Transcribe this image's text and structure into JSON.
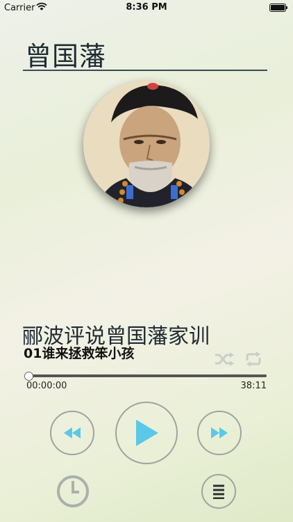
{
  "status_bar": {
    "carrier": "Carrier",
    "time": "8:36 PM",
    "wifi_icon": "wifi-icon",
    "battery_icon": "battery-icon"
  },
  "header": {
    "title": "曾国藩"
  },
  "artwork": {
    "icon": "portrait-image"
  },
  "track": {
    "title": "郦波评说曾国藩家训",
    "subtitle": "01谁来拯救笨小孩"
  },
  "modes": {
    "shuffle_icon": "shuffle-icon",
    "repeat_icon": "repeat-icon"
  },
  "progress": {
    "elapsed": "00:00:00",
    "total": "38:11",
    "fraction": 0.0
  },
  "controls": {
    "rewind_icon": "rewind-icon",
    "play_icon": "play-icon",
    "forward_icon": "fast-forward-icon",
    "timer_icon": "clock-timer-icon",
    "playlist_icon": "playlist-icon"
  },
  "colors": {
    "accent": "#5bc8e8",
    "title": "#1d2b33",
    "ring": "#9ea3a1"
  }
}
